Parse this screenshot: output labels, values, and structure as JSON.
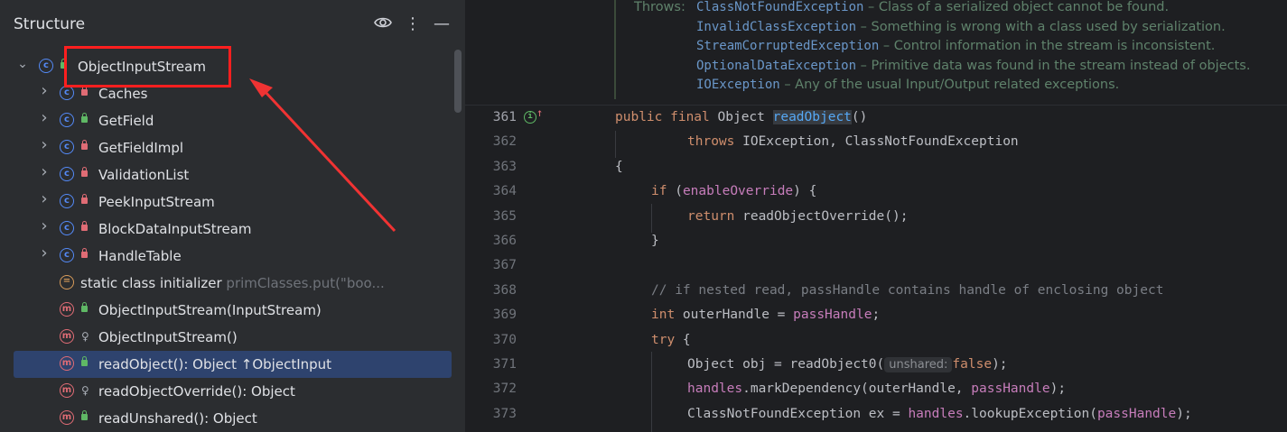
{
  "structure": {
    "title": "Structure",
    "items": [
      {
        "label": "ObjectInputStream",
        "hint": "",
        "icon": "class-icon",
        "visibility": "public",
        "expandable": true,
        "expanded": true,
        "indent": 0,
        "selected": false
      },
      {
        "label": "Caches",
        "hint": "",
        "icon": "class-icon",
        "visibility": "private",
        "expandable": true,
        "expanded": false,
        "indent": 1,
        "selected": false
      },
      {
        "label": "GetField",
        "hint": "",
        "icon": "class-icon",
        "visibility": "public",
        "expandable": true,
        "expanded": false,
        "indent": 1,
        "selected": false
      },
      {
        "label": "GetFieldImpl",
        "hint": "",
        "icon": "class-icon",
        "visibility": "private",
        "expandable": true,
        "expanded": false,
        "indent": 1,
        "selected": false
      },
      {
        "label": "ValidationList",
        "hint": "",
        "icon": "class-icon",
        "visibility": "private",
        "expandable": true,
        "expanded": false,
        "indent": 1,
        "selected": false
      },
      {
        "label": "PeekInputStream",
        "hint": "",
        "icon": "class-icon",
        "visibility": "private",
        "expandable": true,
        "expanded": false,
        "indent": 1,
        "selected": false
      },
      {
        "label": "BlockDataInputStream",
        "hint": "",
        "icon": "class-icon",
        "visibility": "private",
        "expandable": true,
        "expanded": false,
        "indent": 1,
        "selected": false
      },
      {
        "label": "HandleTable",
        "hint": "",
        "icon": "class-icon",
        "visibility": "private",
        "expandable": true,
        "expanded": false,
        "indent": 1,
        "selected": false
      },
      {
        "label": "static class initializer",
        "hint": "primClasses.put(\"boo...",
        "icon": "initializer-icon",
        "visibility": "none",
        "expandable": false,
        "expanded": false,
        "indent": 1,
        "selected": false
      },
      {
        "label": "ObjectInputStream(InputStream)",
        "hint": "",
        "icon": "method-icon",
        "visibility": "public",
        "expandable": false,
        "expanded": false,
        "indent": 1,
        "selected": false
      },
      {
        "label": "ObjectInputStream()",
        "hint": "",
        "icon": "method-icon",
        "visibility": "protected",
        "expandable": false,
        "expanded": false,
        "indent": 1,
        "selected": false
      },
      {
        "label": "readObject(): Object ↑ObjectInput",
        "hint": "",
        "icon": "method-icon",
        "visibility": "public",
        "expandable": false,
        "expanded": false,
        "indent": 1,
        "selected": true
      },
      {
        "label": "readObjectOverride(): Object",
        "hint": "",
        "icon": "method-icon",
        "visibility": "protected",
        "expandable": false,
        "expanded": false,
        "indent": 1,
        "selected": false
      },
      {
        "label": "readUnshared(): Object",
        "hint": "",
        "icon": "method-icon",
        "visibility": "public",
        "expandable": false,
        "expanded": false,
        "indent": 1,
        "selected": false
      }
    ]
  },
  "doc": {
    "throws_label": "Throws:",
    "entries": [
      {
        "name": "ClassNotFoundException",
        "desc": " – Class of a serialized object cannot be found."
      },
      {
        "name": "InvalidClassException",
        "desc": " – Something is wrong with a class used by serialization."
      },
      {
        "name": "StreamCorruptedException",
        "desc": " – Control information in the stream is inconsistent."
      },
      {
        "name": "OptionalDataException",
        "desc": " – Primitive data was found in the stream instead of objects."
      },
      {
        "name": "IOException",
        "desc": " – Any of the usual Input/Output related exceptions."
      }
    ]
  },
  "code": {
    "lines": [
      {
        "num": "361",
        "indent": 0,
        "current": true,
        "tokens": [
          [
            "kw",
            "public final "
          ],
          [
            "t",
            "Object "
          ],
          [
            "fnhl",
            "readObject"
          ],
          [
            "t",
            "()"
          ]
        ]
      },
      {
        "num": "362",
        "indent": 2,
        "current": false,
        "tokens": [
          [
            "kw",
            "throws "
          ],
          [
            "t",
            "IOException, ClassNotFoundException"
          ]
        ]
      },
      {
        "num": "363",
        "indent": 0,
        "current": false,
        "tokens": [
          [
            "t",
            " {"
          ]
        ]
      },
      {
        "num": "364",
        "indent": 1,
        "current": false,
        "tokens": [
          [
            "kw",
            "if "
          ],
          [
            "t",
            "("
          ],
          [
            "field",
            "enableOverride"
          ],
          [
            "t",
            ") {"
          ]
        ]
      },
      {
        "num": "365",
        "indent": 2,
        "current": false,
        "tokens": [
          [
            "kw",
            "return "
          ],
          [
            "t",
            "readObjectOverride();"
          ]
        ]
      },
      {
        "num": "366",
        "indent": 1,
        "current": false,
        "tokens": [
          [
            "t",
            "}"
          ]
        ]
      },
      {
        "num": "367",
        "indent": 0,
        "current": false,
        "tokens": []
      },
      {
        "num": "368",
        "indent": 1,
        "current": false,
        "tokens": [
          [
            "cm",
            "// if nested read, passHandle contains handle of enclosing object"
          ]
        ]
      },
      {
        "num": "369",
        "indent": 1,
        "current": false,
        "tokens": [
          [
            "kw",
            "int "
          ],
          [
            "t",
            "outerHandle = "
          ],
          [
            "field",
            "passHandle"
          ],
          [
            "t",
            ";"
          ]
        ]
      },
      {
        "num": "370",
        "indent": 1,
        "current": false,
        "tokens": [
          [
            "kw",
            "try "
          ],
          [
            "t",
            "{"
          ]
        ]
      },
      {
        "num": "371",
        "indent": 2,
        "current": false,
        "tokens": [
          [
            "t",
            "Object obj = readObject0("
          ],
          [
            "inlay",
            "unshared:"
          ],
          [
            "kw",
            "false"
          ],
          [
            "t",
            ");"
          ]
        ]
      },
      {
        "num": "372",
        "indent": 2,
        "current": false,
        "tokens": [
          [
            "field",
            "handles"
          ],
          [
            "t",
            ".markDependency(outerHandle, "
          ],
          [
            "field",
            "passHandle"
          ],
          [
            "t",
            ");"
          ]
        ]
      },
      {
        "num": "373",
        "indent": 2,
        "current": false,
        "tokens": [
          [
            "t",
            "ClassNotFoundException ex = "
          ],
          [
            "field",
            "handles"
          ],
          [
            "t",
            ".lookupException("
          ],
          [
            "field",
            "passHandle"
          ],
          [
            "t",
            ");"
          ]
        ]
      }
    ]
  }
}
